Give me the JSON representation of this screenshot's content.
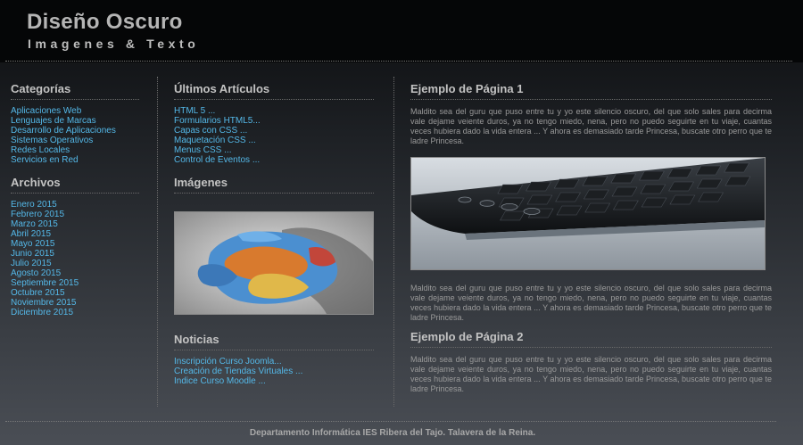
{
  "header": {
    "title": "Diseño Oscuro",
    "subtitle": "Imagenes & Texto"
  },
  "categorias": {
    "title": "Categorías",
    "items": [
      "Aplicaciones Web",
      "Lenguajes de Marcas",
      "Desarrollo de Aplicaciones",
      "Sistemas Operativos",
      "Redes Locales",
      "Servicios en Red"
    ]
  },
  "archivos": {
    "title": "Archivos",
    "items": [
      "Enero 2015",
      "Febrero 2015",
      "Marzo 2015",
      "Abril 2015",
      "Mayo 2015",
      "Junio 2015",
      "Julio 2015",
      "Agosto 2015",
      "Septiembre 2015",
      "Octubre 2015",
      "Noviembre 2015",
      "Diciembre 2015"
    ]
  },
  "articulos": {
    "title": "Últimos Artículos",
    "items": [
      "HTML 5 ...",
      "Formularios HTML5...",
      "Capas con CSS ...",
      "Maquetación CSS ...",
      "Menus CSS ...",
      "Control de Eventos ..."
    ]
  },
  "imagenes": {
    "title": "Imágenes",
    "image": "hands-globe-image"
  },
  "noticias": {
    "title": "Noticias",
    "items": [
      "Inscripción Curso Joomla...",
      "Creación de Tiendas Virtuales ...",
      "Indice Curso Moodle ..."
    ]
  },
  "main": {
    "article1": {
      "title": "Ejemplo de Página 1",
      "para1": "Maldito sea del guru que puso entre tu y yo este silencio oscuro, del que solo sales para decirma vale dejame veiente duros, ya no tengo miedo, nena, pero no puedo seguirte en tu viaje, cuantas veces hubiera dado la vida entera ... Y ahora es demasiado tarde Princesa, buscate otro perro que te ladre Princesa.",
      "image": "keyboard-image",
      "para2": "Maldito sea del guru que puso entre tu y yo este silencio oscuro, del que solo sales para decirma vale dejame veiente duros, ya no tengo miedo, nena, pero no puedo seguirte en tu viaje, cuantas veces hubiera dado la vida entera ... Y ahora es demasiado tarde Princesa, buscate otro perro que te ladre Princesa."
    },
    "article2": {
      "title": "Ejemplo de Página 2",
      "para1": "Maldito sea del guru que puso entre tu y yo este silencio oscuro, del que solo sales para decirma vale dejame veiente duros, ya no tengo miedo, nena, pero no puedo seguirte en tu viaje, cuantas veces hubiera dado la vida entera ... Y ahora es demasiado tarde Princesa, buscate otro perro que te ladre Princesa."
    }
  },
  "footer": {
    "text": "Departamento Informática IES Ribera del Tajo. Talavera de la Reina."
  },
  "colors": {
    "link": "#54b8e8",
    "heading": "#c3c3c3",
    "text": "#9a9a9a"
  }
}
